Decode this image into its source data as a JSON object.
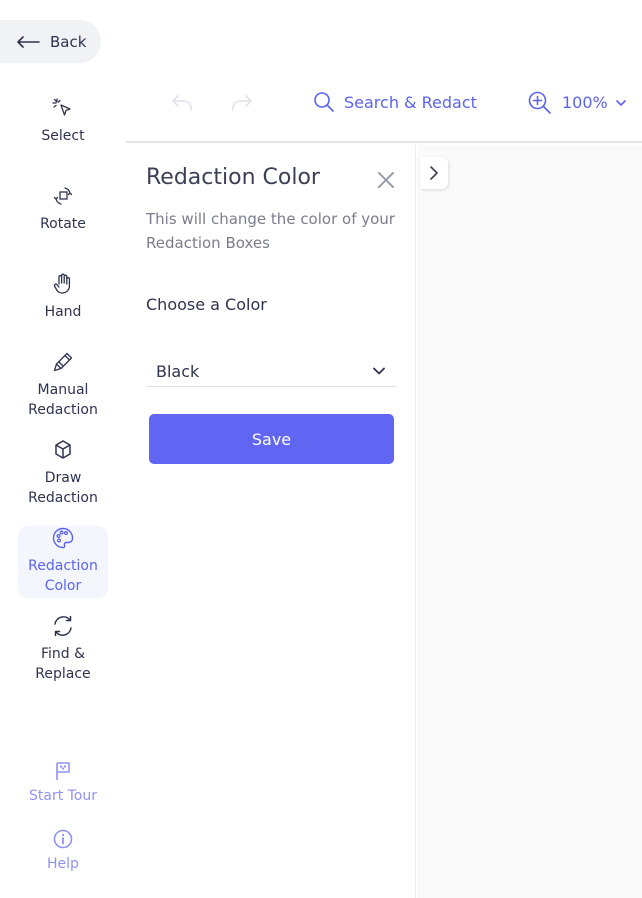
{
  "back": {
    "label": "Back"
  },
  "toolbar": {
    "search_label": "Search & Redact",
    "zoom_label": "100%"
  },
  "tools": [
    {
      "label": "Select",
      "icon": "cursor-select-icon"
    },
    {
      "label": "Rotate",
      "icon": "rotate-icon"
    },
    {
      "label": "Hand",
      "icon": "hand-icon"
    },
    {
      "label": "Manual\nRedaction",
      "icon": "pen-icon"
    },
    {
      "label": "Draw\nRedaction",
      "icon": "cube-icon"
    },
    {
      "label": "Redaction\nColor",
      "icon": "palette-icon",
      "active": true
    },
    {
      "label": "Find &\nReplace",
      "icon": "refresh-circle-icon"
    }
  ],
  "bottom": {
    "tour_label": "Start Tour",
    "help_label": "Help"
  },
  "panel": {
    "title": "Redaction Color",
    "description": "This will change the color of your Redaction Boxes",
    "choose_label": "Choose a Color",
    "selected_color": "Black",
    "save_label": "Save"
  },
  "colors": {
    "accent": "#5b63f0",
    "button": "#6066f2",
    "text": "#2f3350"
  }
}
